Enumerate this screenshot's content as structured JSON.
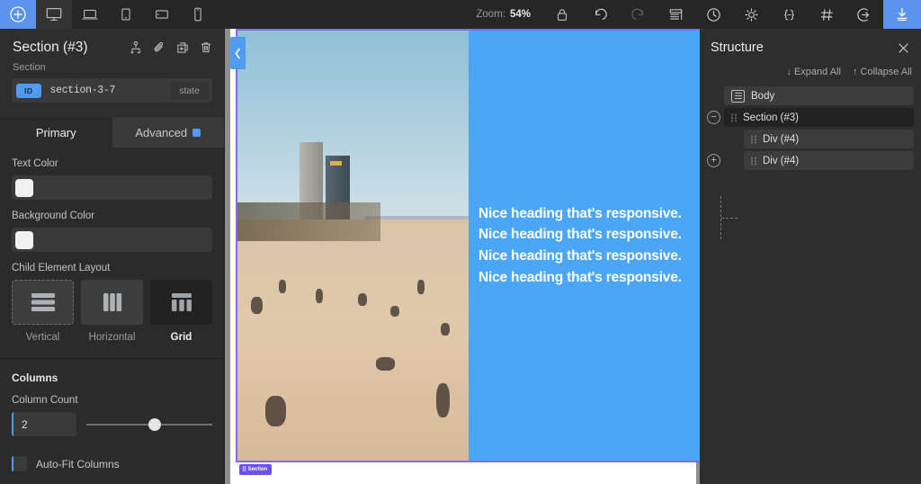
{
  "toolbar": {
    "add_label": "add-element",
    "devices": [
      {
        "name": "desktop",
        "label": "Desktop",
        "active": true
      },
      {
        "name": "laptop",
        "label": "Laptop",
        "active": false
      },
      {
        "name": "tablet-portrait",
        "label": "Tablet Portrait",
        "active": false
      },
      {
        "name": "tablet-landscape",
        "label": "Tablet Landscape",
        "active": false
      },
      {
        "name": "mobile",
        "label": "Mobile",
        "active": false
      }
    ],
    "zoom_label": "Zoom:",
    "zoom_value": "54%",
    "lock_label": "Lock",
    "undo_label": "Undo",
    "redo_label": "Redo",
    "layers_label": "Layers",
    "history_label": "History",
    "settings_label": "Settings",
    "code_label": "Code",
    "grid_label": "Grid",
    "login_label": "Log in",
    "export_label": "Export"
  },
  "inspector": {
    "title": "Section (#3)",
    "subtitle": "Section",
    "id_badge": "ID",
    "id_value": "section-3-7",
    "state_button": "state",
    "head_icons": [
      "select-parent-icon",
      "link-icon",
      "duplicate-icon",
      "delete-icon"
    ],
    "tabs": [
      {
        "label": "Primary",
        "active": true,
        "dot": false
      },
      {
        "label": "Advanced",
        "active": false,
        "dot": true
      }
    ],
    "text_color": {
      "label": "Text Color",
      "value": "#FFFFFF"
    },
    "background_color": {
      "label": "Background Color",
      "value": "#FFFFFF"
    },
    "child_layout": {
      "label": "Child Element Layout",
      "options": [
        {
          "label": "Vertical",
          "selected": false
        },
        {
          "label": "Horizontal",
          "selected": false
        },
        {
          "label": "Grid",
          "selected": true
        }
      ]
    },
    "columns": {
      "section_title": "Columns",
      "count_label": "Column Count",
      "count_value": "2",
      "slider_percent": 54,
      "autofit_label": "Auto-Fit Columns",
      "autofit_checked": false
    }
  },
  "canvas": {
    "zoom": "54%",
    "section_badge": "Section",
    "image_alt": "Barcelona beach with towers",
    "blue_bg": "#4BA6F7",
    "headings": [
      "Nice heading that's responsive.",
      "Nice heading that's responsive.",
      "Nice heading that's responsive.",
      "Nice heading that's responsive."
    ]
  },
  "structure": {
    "title": "Structure",
    "close_label": "Close",
    "expand_all": "↓ Expand All",
    "collapse_all": "↑ Collapse All",
    "nodes": [
      {
        "label": "Body",
        "depth": 0,
        "toggle": "none",
        "icon": "body-icon",
        "selected": false
      },
      {
        "label": "Section (#3)",
        "depth": 0,
        "toggle": "minus",
        "icon": "grip",
        "selected": true
      },
      {
        "label": "Div (#4)",
        "depth": 1,
        "toggle": "none",
        "icon": "grip",
        "selected": false
      },
      {
        "label": "Div (#4)",
        "depth": 1,
        "toggle": "plus",
        "icon": "grip",
        "selected": false
      }
    ]
  }
}
